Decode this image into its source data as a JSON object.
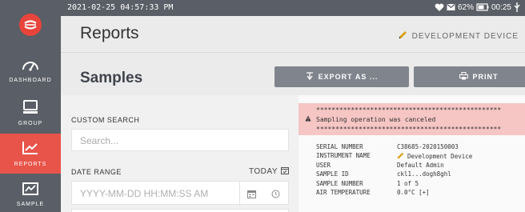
{
  "status": {
    "datetime": "2021-02-25 04:57:33 PM",
    "battery_percent": "62%",
    "battery_time": "00:25"
  },
  "sidebar": {
    "items": [
      {
        "label": "DASHBOARD",
        "icon": "gauge-icon"
      },
      {
        "label": "GROUP",
        "icon": "monitor-icon"
      },
      {
        "label": "REPORTS",
        "icon": "chart-icon",
        "active": true
      },
      {
        "label": "SAMPLE",
        "icon": "line-chart-icon"
      }
    ]
  },
  "header": {
    "title": "Reports",
    "device": "DEVELOPMENT DEVICE"
  },
  "subheader": {
    "title": "Samples",
    "export_label": "EXPORT AS ...",
    "print_label": "PRINT"
  },
  "form": {
    "custom_search_label": "CUSTOM SEARCH",
    "search_placeholder": "Search...",
    "date_range_label": "DATE RANGE",
    "today_label": "TODAY",
    "date_placeholder": "YYYY-MM-DD HH:MM:SS AM"
  },
  "report": {
    "stars": "************************************************",
    "alert_message": "Sampling operation was canceled",
    "rows": [
      {
        "key": "SERIAL NUMBER",
        "value": "C38685-2020150003"
      },
      {
        "key": "INSTRUMENT NAME",
        "value": "Development Device",
        "icon": "pencil-icon"
      },
      {
        "key": "USER",
        "value": "Default Admin"
      },
      {
        "key": "SAMPLE ID",
        "value": "ckl1...dogh8ghl"
      },
      {
        "key": "SAMPLE NUMBER",
        "value": "1 of 5"
      },
      {
        "key": "AIR TEMPERATURE",
        "value": "0.0°C [+]"
      }
    ]
  },
  "colors": {
    "sidebar": "#5a5e66",
    "accent": "#e8544a",
    "button": "#80848c",
    "alert": "#f6c6c4"
  }
}
